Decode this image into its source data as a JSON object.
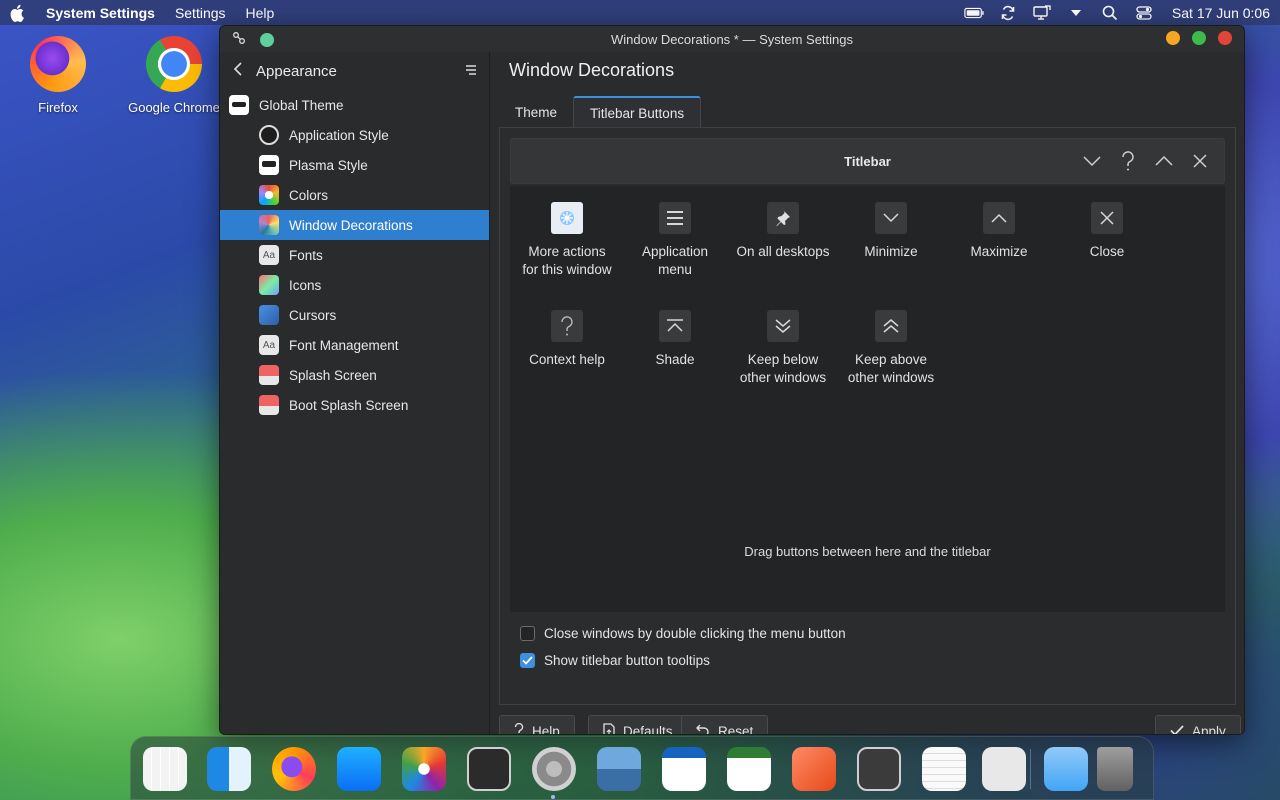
{
  "menubar": {
    "app_name": "System Settings",
    "items": [
      "Settings",
      "Help"
    ],
    "clock": "Sat 17 Jun 0:06"
  },
  "desktop": {
    "icons": [
      {
        "label": "Firefox"
      },
      {
        "label": "Google Chrome"
      }
    ]
  },
  "window": {
    "title": "Window Decorations * — System Settings"
  },
  "sidebar": {
    "header": "Appearance",
    "items": [
      {
        "label": "Global Theme"
      },
      {
        "label": "Application Style"
      },
      {
        "label": "Plasma Style"
      },
      {
        "label": "Colors"
      },
      {
        "label": "Window Decorations"
      },
      {
        "label": "Fonts"
      },
      {
        "label": "Icons"
      },
      {
        "label": "Cursors"
      },
      {
        "label": "Font Management"
      },
      {
        "label": "Splash Screen"
      },
      {
        "label": "Boot Splash Screen"
      }
    ]
  },
  "main": {
    "title": "Window Decorations",
    "tabs": [
      {
        "label": "Theme"
      },
      {
        "label": "Titlebar Buttons"
      }
    ],
    "titlebar_preview": {
      "label": "Titlebar"
    },
    "buttons": [
      {
        "label": "More actions\nfor this window"
      },
      {
        "label": "Application\nmenu"
      },
      {
        "label": "On all desktops"
      },
      {
        "label": "Minimize"
      },
      {
        "label": "Maximize"
      },
      {
        "label": "Close"
      },
      {
        "label": "Context help"
      },
      {
        "label": "Shade"
      },
      {
        "label": "Keep below\nother windows"
      },
      {
        "label": "Keep above\nother windows"
      }
    ],
    "hint": "Drag buttons between here and the titlebar",
    "options": [
      {
        "label": "Close windows by double clicking the menu button",
        "checked": false
      },
      {
        "label": "Show titlebar button tooltips",
        "checked": true
      }
    ]
  },
  "footer": {
    "help": "Help",
    "defaults": "Defaults",
    "reset": "Reset",
    "apply": "Apply"
  },
  "colors": {
    "accent": "#2f7fd0",
    "window_bg": "#2a2b2d",
    "minimize_dot": "#f5a623",
    "maximize_dot": "#3dbb4a",
    "close_dot": "#e0453a"
  }
}
